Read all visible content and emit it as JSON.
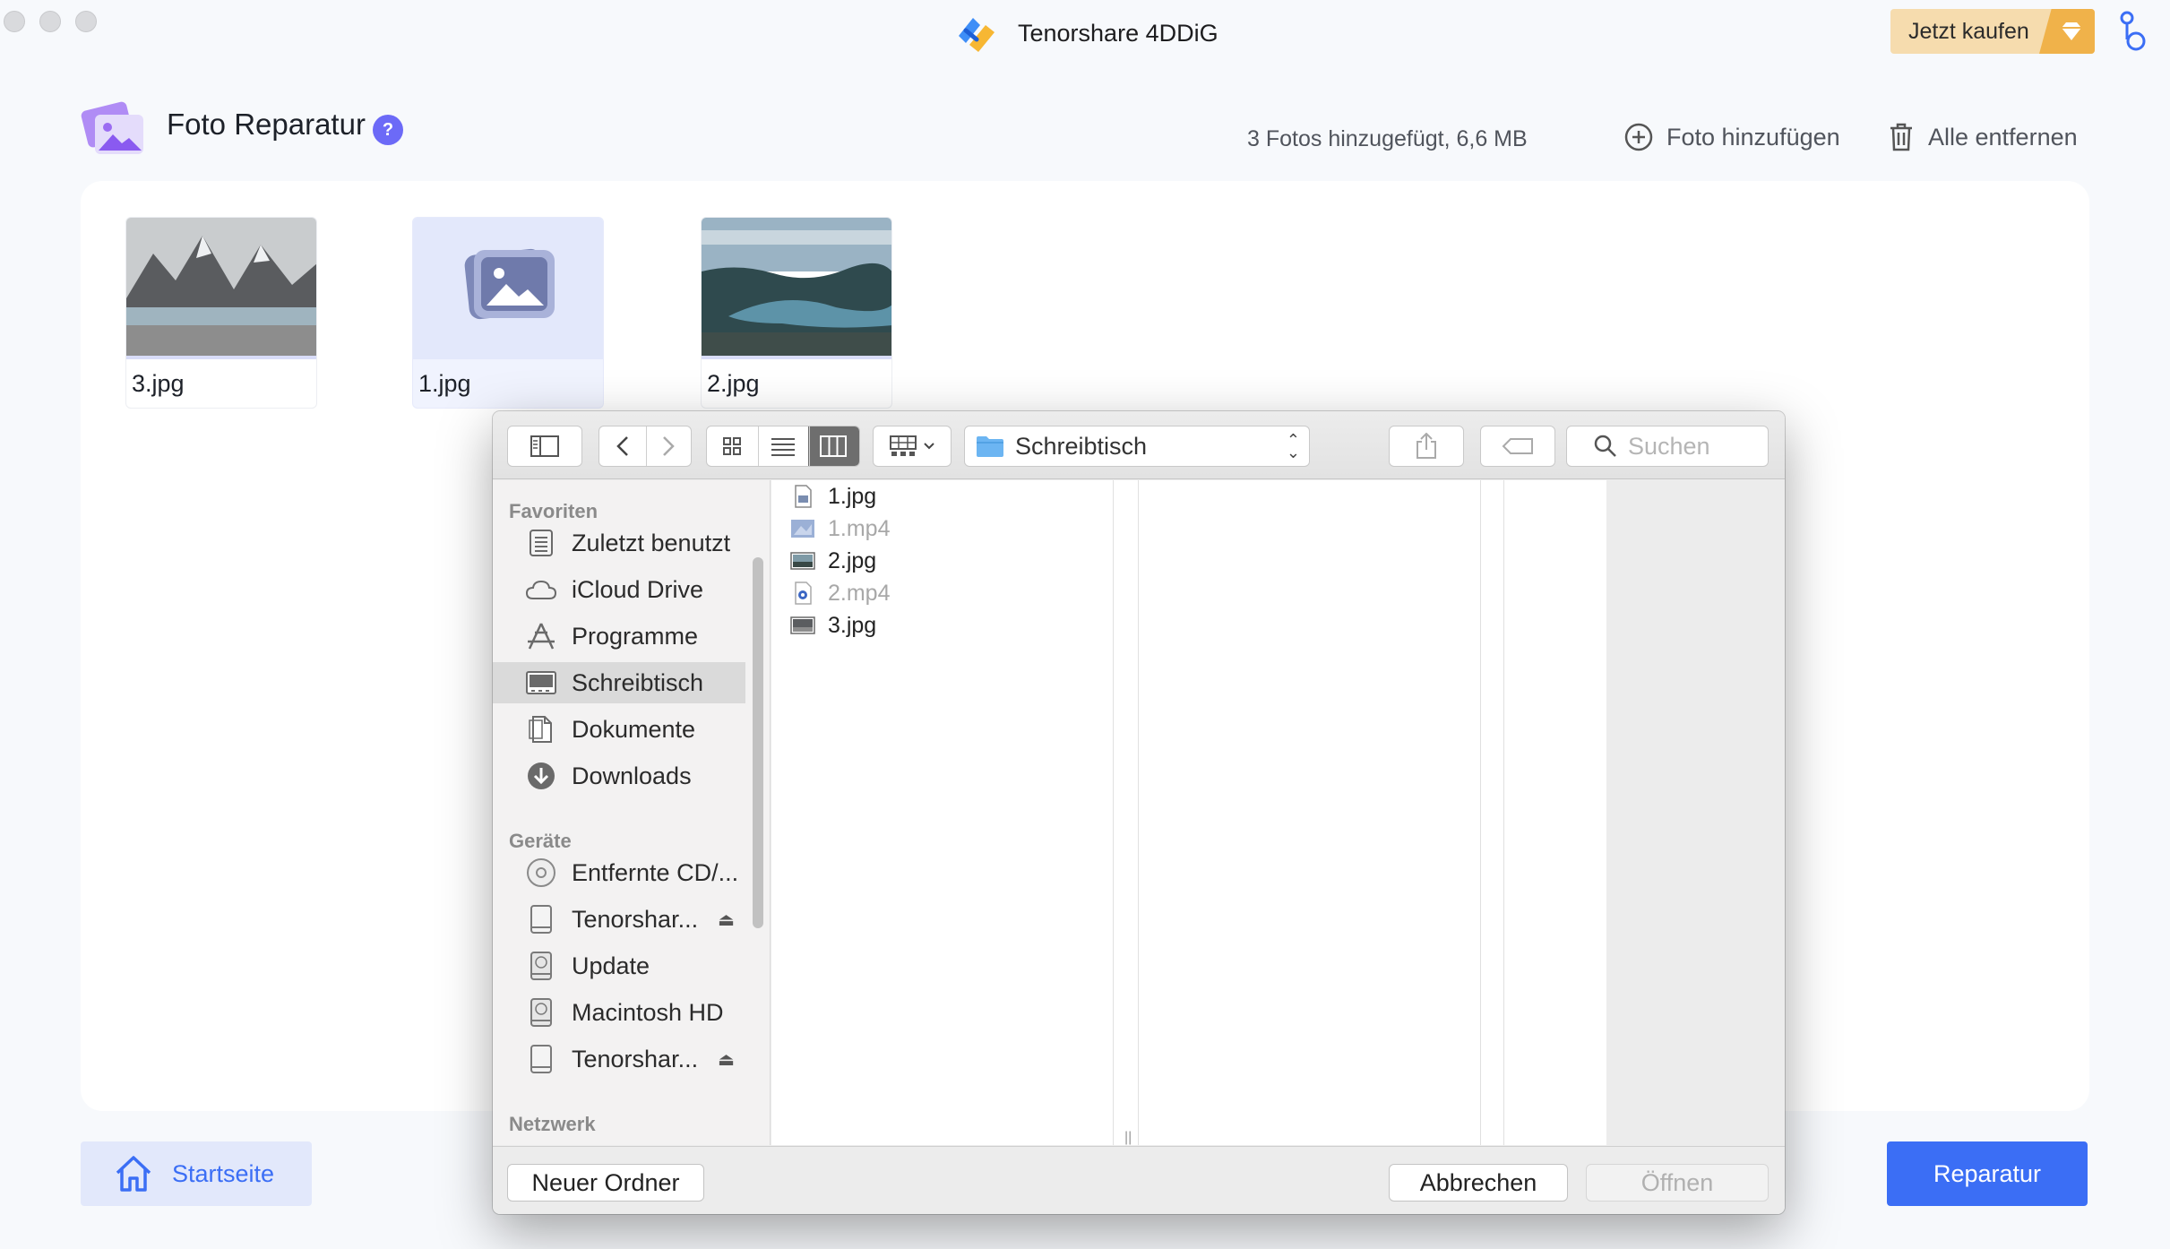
{
  "app": {
    "title": "Tenorshare 4DDiG",
    "buy_label": "Jetzt kaufen"
  },
  "header": {
    "title": "Foto Reparatur",
    "help": "?",
    "summary": "3 Fotos hinzugefügt, 6,6 MB",
    "add_label": "Foto hinzufügen",
    "remove_label": "Alle entfernen"
  },
  "photos": [
    {
      "name": "3.jpg",
      "kind": "mountain-lake"
    },
    {
      "name": "1.jpg",
      "kind": "placeholder"
    },
    {
      "name": "2.jpg",
      "kind": "river-valley"
    }
  ],
  "footer": {
    "home_label": "Startseite",
    "repair_label": "Reparatur"
  },
  "dialog": {
    "location": "Schreibtisch",
    "search_placeholder": "Suchen",
    "sidebar": {
      "favorites_heading": "Favoriten",
      "favorites": [
        {
          "label": "Zuletzt benutzt",
          "icon": "recents-icon"
        },
        {
          "label": "iCloud Drive",
          "icon": "cloud-icon"
        },
        {
          "label": "Programme",
          "icon": "applications-icon"
        },
        {
          "label": "Schreibtisch",
          "icon": "desktop-icon",
          "selected": true
        },
        {
          "label": "Dokumente",
          "icon": "document-icon"
        },
        {
          "label": "Downloads",
          "icon": "download-icon"
        }
      ],
      "devices_heading": "Geräte",
      "devices": [
        {
          "label": "Entfernte CD/...",
          "icon": "disc-icon"
        },
        {
          "label": "Tenorshar...",
          "icon": "drive-icon",
          "eject": true
        },
        {
          "label": "Update",
          "icon": "hard-disk-icon"
        },
        {
          "label": "Macintosh HD",
          "icon": "hard-disk-icon"
        },
        {
          "label": "Tenorshar...",
          "icon": "drive-icon",
          "eject": true
        }
      ],
      "network_heading": "Netzwerk"
    },
    "files": [
      {
        "name": "1.jpg",
        "enabled": true,
        "icon": "jpg-file-icon"
      },
      {
        "name": "1.mp4",
        "enabled": false,
        "icon": "video-file-icon"
      },
      {
        "name": "2.jpg",
        "enabled": true,
        "icon": "image-file-icon"
      },
      {
        "name": "2.mp4",
        "enabled": false,
        "icon": "quicktime-file-icon"
      },
      {
        "name": "3.jpg",
        "enabled": true,
        "icon": "image-file-icon"
      }
    ],
    "new_folder_label": "Neuer Ordner",
    "cancel_label": "Abbrechen",
    "open_label": "Öffnen"
  }
}
